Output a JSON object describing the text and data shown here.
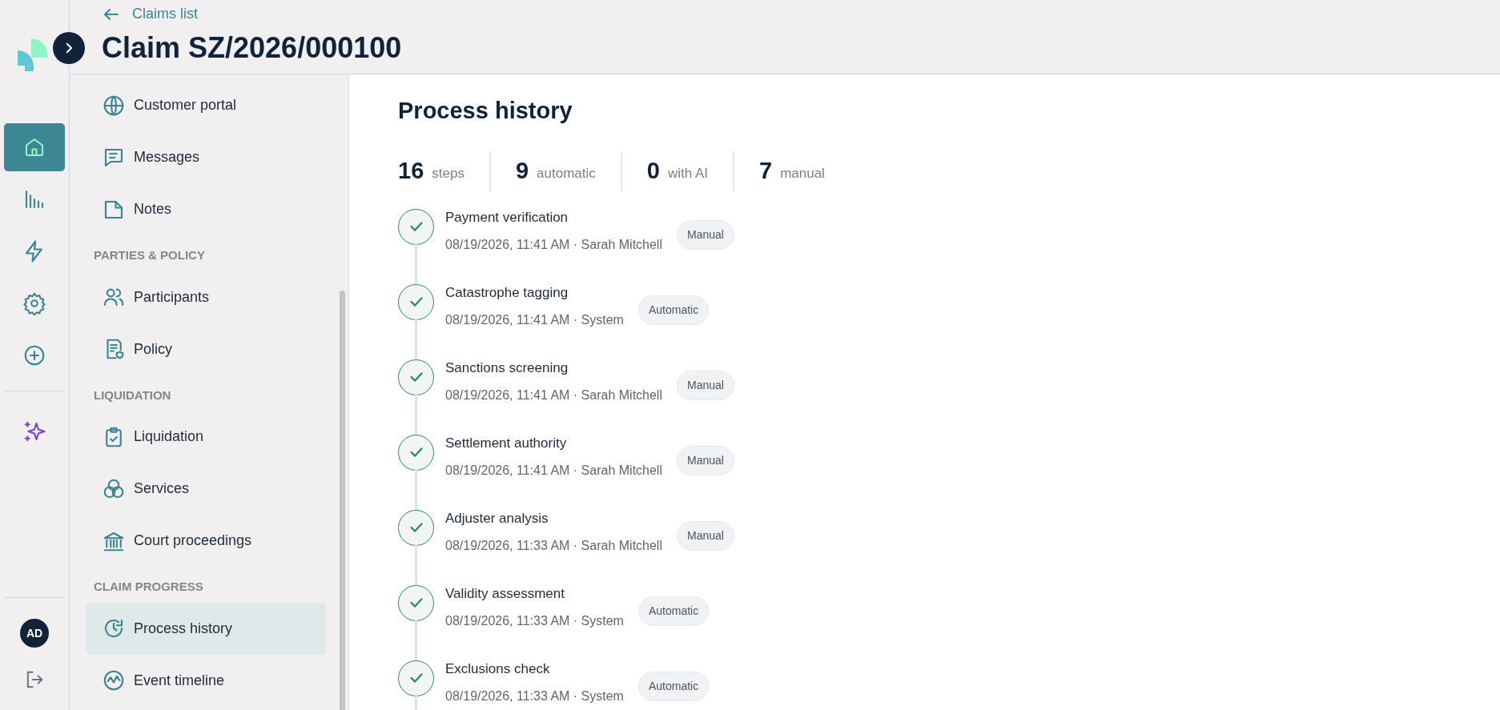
{
  "header": {
    "back_link": "Claims list",
    "title": "Claim SZ/2026/000100"
  },
  "rail": {
    "items": [
      {
        "selected": true
      },
      {
        "selected": false
      },
      {
        "selected": false
      },
      {
        "selected": false
      },
      {
        "selected": false
      }
    ],
    "avatar": "AD"
  },
  "sidebar": {
    "sections": [
      {
        "items": [
          {
            "label": "Customer portal",
            "selected": false
          },
          {
            "label": "Messages",
            "selected": false
          },
          {
            "label": "Notes",
            "selected": false
          }
        ]
      },
      {
        "heading": "PARTIES & POLICY",
        "items": [
          {
            "label": "Participants",
            "selected": false
          },
          {
            "label": "Policy",
            "selected": false
          }
        ]
      },
      {
        "heading": "LIQUIDATION",
        "items": [
          {
            "label": "Liquidation",
            "selected": false
          },
          {
            "label": "Services",
            "selected": false
          },
          {
            "label": "Court proceedings",
            "selected": false
          }
        ]
      },
      {
        "heading": "CLAIM PROGRESS",
        "items": [
          {
            "label": "Process history",
            "selected": true
          },
          {
            "label": "Event timeline",
            "selected": false
          }
        ]
      }
    ]
  },
  "main": {
    "title": "Process history",
    "stats": [
      {
        "value": "16",
        "label": "steps"
      },
      {
        "value": "9",
        "label": "automatic"
      },
      {
        "value": "0",
        "label": "with AI"
      },
      {
        "value": "7",
        "label": "manual"
      }
    ],
    "steps": [
      {
        "title": "Payment verification",
        "meta": "08/19/2026, 11:41 AM · Sarah Mitchell",
        "badge": "Manual",
        "completed": true
      },
      {
        "title": "Catastrophe tagging",
        "meta": "08/19/2026, 11:41 AM · System",
        "badge": "Automatic",
        "completed": true
      },
      {
        "title": "Sanctions screening",
        "meta": "08/19/2026, 11:41 AM · Sarah Mitchell",
        "badge": "Manual",
        "completed": true
      },
      {
        "title": "Settlement authority",
        "meta": "08/19/2026, 11:41 AM · Sarah Mitchell",
        "badge": "Manual",
        "completed": true
      },
      {
        "title": "Adjuster analysis",
        "meta": "08/19/2026, 11:33 AM · Sarah Mitchell",
        "badge": "Manual",
        "completed": true
      },
      {
        "title": "Validity assessment",
        "meta": "08/19/2026, 11:33 AM · System",
        "badge": "Automatic",
        "completed": true
      },
      {
        "title": "Exclusions check",
        "meta": "08/19/2026, 11:33 AM · System",
        "badge": "Automatic",
        "completed": true
      }
    ]
  }
}
